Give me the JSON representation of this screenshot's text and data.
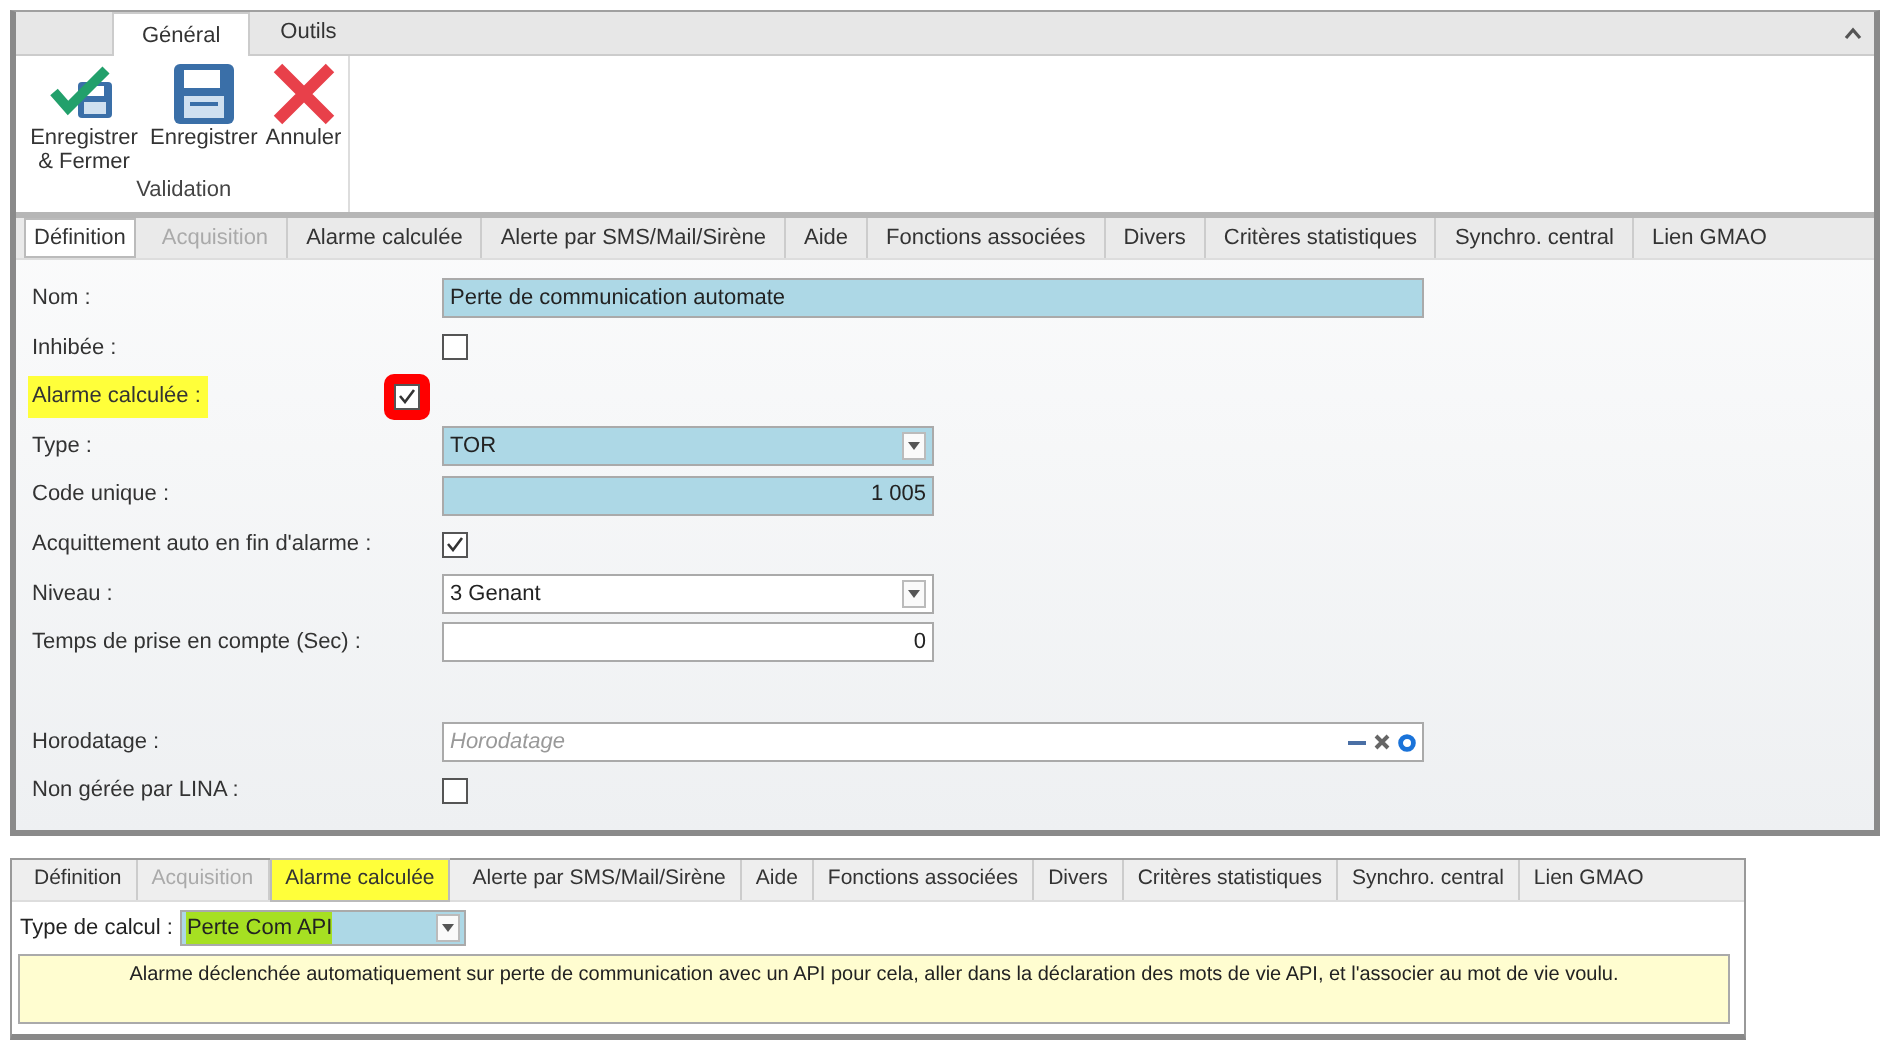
{
  "ribbon": {
    "tabs": [
      {
        "label": "Général",
        "selected": true
      },
      {
        "label": "Outils",
        "selected": false
      }
    ],
    "buttons": [
      {
        "kind": "save-close",
        "label": "Enregistrer & Fermer"
      },
      {
        "kind": "save",
        "label": "Enregistrer"
      },
      {
        "kind": "cancel",
        "label": "Annuler"
      }
    ],
    "group_label": "Validation"
  },
  "tabs": [
    {
      "label": "Définition",
      "selected": true,
      "disabled": false
    },
    {
      "label": "Acquisition",
      "selected": false,
      "disabled": true
    },
    {
      "label": "Alarme calculée",
      "selected": false,
      "disabled": false
    },
    {
      "label": "Alerte par SMS/Mail/Sirène",
      "selected": false,
      "disabled": false
    },
    {
      "label": "Aide",
      "selected": false,
      "disabled": false
    },
    {
      "label": "Fonctions associées",
      "selected": false,
      "disabled": false
    },
    {
      "label": "Divers",
      "selected": false,
      "disabled": false
    },
    {
      "label": "Critères statistiques",
      "selected": false,
      "disabled": false
    },
    {
      "label": "Synchro. central",
      "selected": false,
      "disabled": false
    },
    {
      "label": "Lien GMAO",
      "selected": false,
      "disabled": false
    }
  ],
  "fields": [
    {
      "label": "Nom :",
      "kind": "text",
      "value": "Perte de communication automate",
      "required": true,
      "highlighted": false
    },
    {
      "label": "Inhibée :",
      "kind": "checkbox",
      "checked": false,
      "marked": false,
      "highlighted": false
    },
    {
      "label": "Alarme calculée :",
      "kind": "checkbox",
      "checked": true,
      "marked": true,
      "highlighted": true
    },
    {
      "label": "Type :",
      "kind": "select",
      "value": "TOR",
      "required": true,
      "highlighted": false
    },
    {
      "label": "Code unique :",
      "kind": "number",
      "value": "1 005",
      "required": true,
      "highlighted": false
    },
    {
      "label": "Acquittement auto en fin d'alarme :",
      "kind": "checkbox",
      "checked": true,
      "marked": false,
      "highlighted": false
    },
    {
      "label": "Niveau :",
      "kind": "select",
      "value": "3 Genant",
      "required": false,
      "highlighted": false
    },
    {
      "label": "Temps de prise en compte (Sec) :",
      "kind": "number",
      "value": "0",
      "required": false,
      "highlighted": false
    },
    {
      "label": "Horodatage :",
      "kind": "picker",
      "placeholder": "Horodatage",
      "required": false,
      "highlighted": false
    },
    {
      "label": "Non gérée par LINA :",
      "kind": "checkbox",
      "checked": false,
      "marked": false,
      "highlighted": false
    }
  ],
  "detail": {
    "tabs": [
      {
        "label": "Définition",
        "selected": false,
        "disabled": false,
        "highlighted": false
      },
      {
        "label": "Acquisition",
        "selected": false,
        "disabled": true,
        "highlighted": false
      },
      {
        "label": "Alarme calculée",
        "selected": true,
        "disabled": false,
        "highlighted": true
      },
      {
        "label": "Alerte par SMS/Mail/Sirène",
        "selected": false,
        "disabled": false,
        "highlighted": false
      },
      {
        "label": "Aide",
        "selected": false,
        "disabled": false,
        "highlighted": false
      },
      {
        "label": "Fonctions associées",
        "selected": false,
        "disabled": false,
        "highlighted": false
      },
      {
        "label": "Divers",
        "selected": false,
        "disabled": false,
        "highlighted": false
      },
      {
        "label": "Critères statistiques",
        "selected": false,
        "disabled": false,
        "highlighted": false
      },
      {
        "label": "Synchro. central",
        "selected": false,
        "disabled": false,
        "highlighted": false
      },
      {
        "label": "Lien GMAO",
        "selected": false,
        "disabled": false,
        "highlighted": false
      }
    ],
    "calc_label": "Type de calcul :",
    "calc_value": "Perte Com API",
    "calc_highlighted": true,
    "description": "Alarme déclenchée automatiquement sur perte de communication avec un API pour cela, aller dans la déclaration des mots de vie API, et l'associer au mot de vie voulu."
  }
}
